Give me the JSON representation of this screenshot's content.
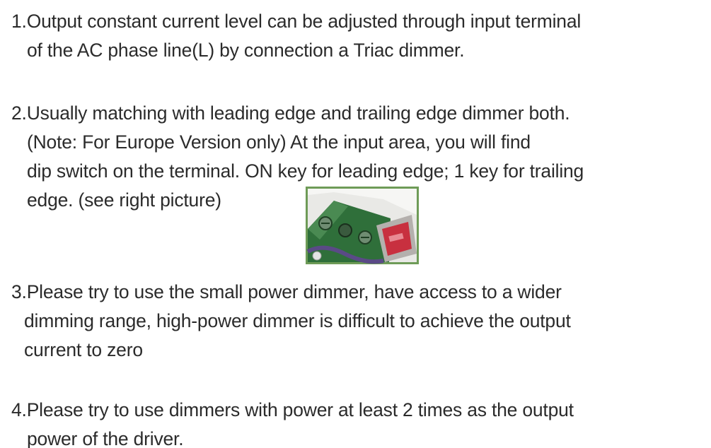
{
  "items": [
    {
      "lines": [
        "1.Output constant current level can be adjusted through input terminal",
        "of the AC phase line(L) by connection a Triac dimmer."
      ]
    },
    {
      "lines": [
        "2.Usually matching with leading edge and trailing edge dimmer both.",
        "(Note: For Europe Version only)  At the input area, you will find",
        "dip switch on the terminal. ON key for leading edge; 1 key for trailing",
        "edge. (see right picture)"
      ]
    },
    {
      "lines": [
        "3.Please try to use the small power dimmer, have access to a wider",
        "dimming range, high-power dimmer is difficult to achieve the output",
        "current to zero"
      ]
    },
    {
      "lines": [
        "4.Please try to use dimmers with power at least 2 times as the output",
        "power of the driver."
      ]
    }
  ],
  "photo": {
    "icon": "dip-switch-terminal-photo",
    "colors": {
      "border": "#6e9b57",
      "terminal_block": "#3f7a45",
      "dip_switch": "#c8303f",
      "background": "#ececec",
      "wire": "#5a4a86"
    }
  }
}
